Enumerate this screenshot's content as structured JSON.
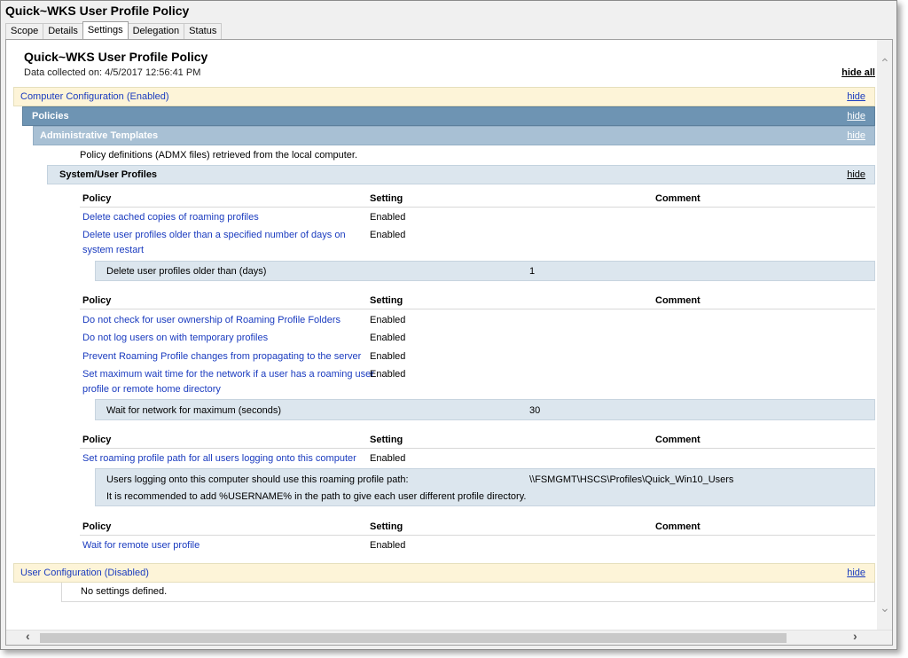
{
  "window": {
    "title": "Quick~WKS User Profile Policy"
  },
  "tabs": [
    {
      "label": "Scope"
    },
    {
      "label": "Details"
    },
    {
      "label": "Settings"
    },
    {
      "label": "Delegation"
    },
    {
      "label": "Status"
    }
  ],
  "report": {
    "title": "Quick~WKS User Profile Policy",
    "collected": "Data collected on: 4/5/2017 12:56:41 PM",
    "hide_all": "hide all",
    "hide": "hide",
    "computer_config": "Computer Configuration (Enabled)",
    "policies": "Policies",
    "admin_templates": "Administrative Templates",
    "admx_note": "Policy definitions (ADMX files) retrieved from the local computer.",
    "section": "System/User Profiles",
    "col_policy": "Policy",
    "col_setting": "Setting",
    "col_comment": "Comment",
    "group1": [
      {
        "policy": "Delete cached copies of roaming profiles",
        "setting": "Enabled"
      },
      {
        "policy_line1": "Delete user profiles older than a specified number of days on",
        "policy_line2": "system restart",
        "setting": "Enabled"
      }
    ],
    "group1_sub": {
      "label": "Delete user profiles older than (days)",
      "value": "1"
    },
    "group2": [
      {
        "policy": "Do not check for user ownership of Roaming Profile Folders",
        "setting": "Enabled"
      },
      {
        "policy": "Do not log users on with temporary profiles",
        "setting": "Enabled"
      },
      {
        "policy": "Prevent Roaming Profile changes from propagating to the server",
        "setting": "Enabled"
      },
      {
        "policy_line1": "Set maximum wait time for the network if a user has a roaming user",
        "policy_line2": "profile or remote home directory",
        "setting": "Enabled"
      }
    ],
    "group2_sub": {
      "label": "Wait for network for maximum (seconds)",
      "value": "30"
    },
    "group3": [
      {
        "policy": "Set roaming profile path for all users logging onto this computer",
        "setting": "Enabled"
      }
    ],
    "group3_sub": {
      "label": "Users logging onto this computer should use this roaming profile path:",
      "value": "\\\\FSMGMT\\HSCS\\Profiles\\Quick_Win10_Users",
      "note": "It is recommended to add %USERNAME% in the path to give each user different profile directory."
    },
    "group4": [
      {
        "policy": "Wait for remote user profile",
        "setting": "Enabled"
      }
    ],
    "user_config": "User Configuration (Disabled)",
    "no_settings": "No settings defined."
  },
  "icons": [
    "chevron-up-icon",
    "chevron-down-icon",
    "chevron-left-icon",
    "chevron-right-icon"
  ],
  "colors": {
    "link": "#1a3bbf",
    "config_bar": "#fdf4d8",
    "policies_bar": "#6e94b3",
    "admin_bar": "#a8c0d4",
    "section_bar": "#dce6ee"
  }
}
